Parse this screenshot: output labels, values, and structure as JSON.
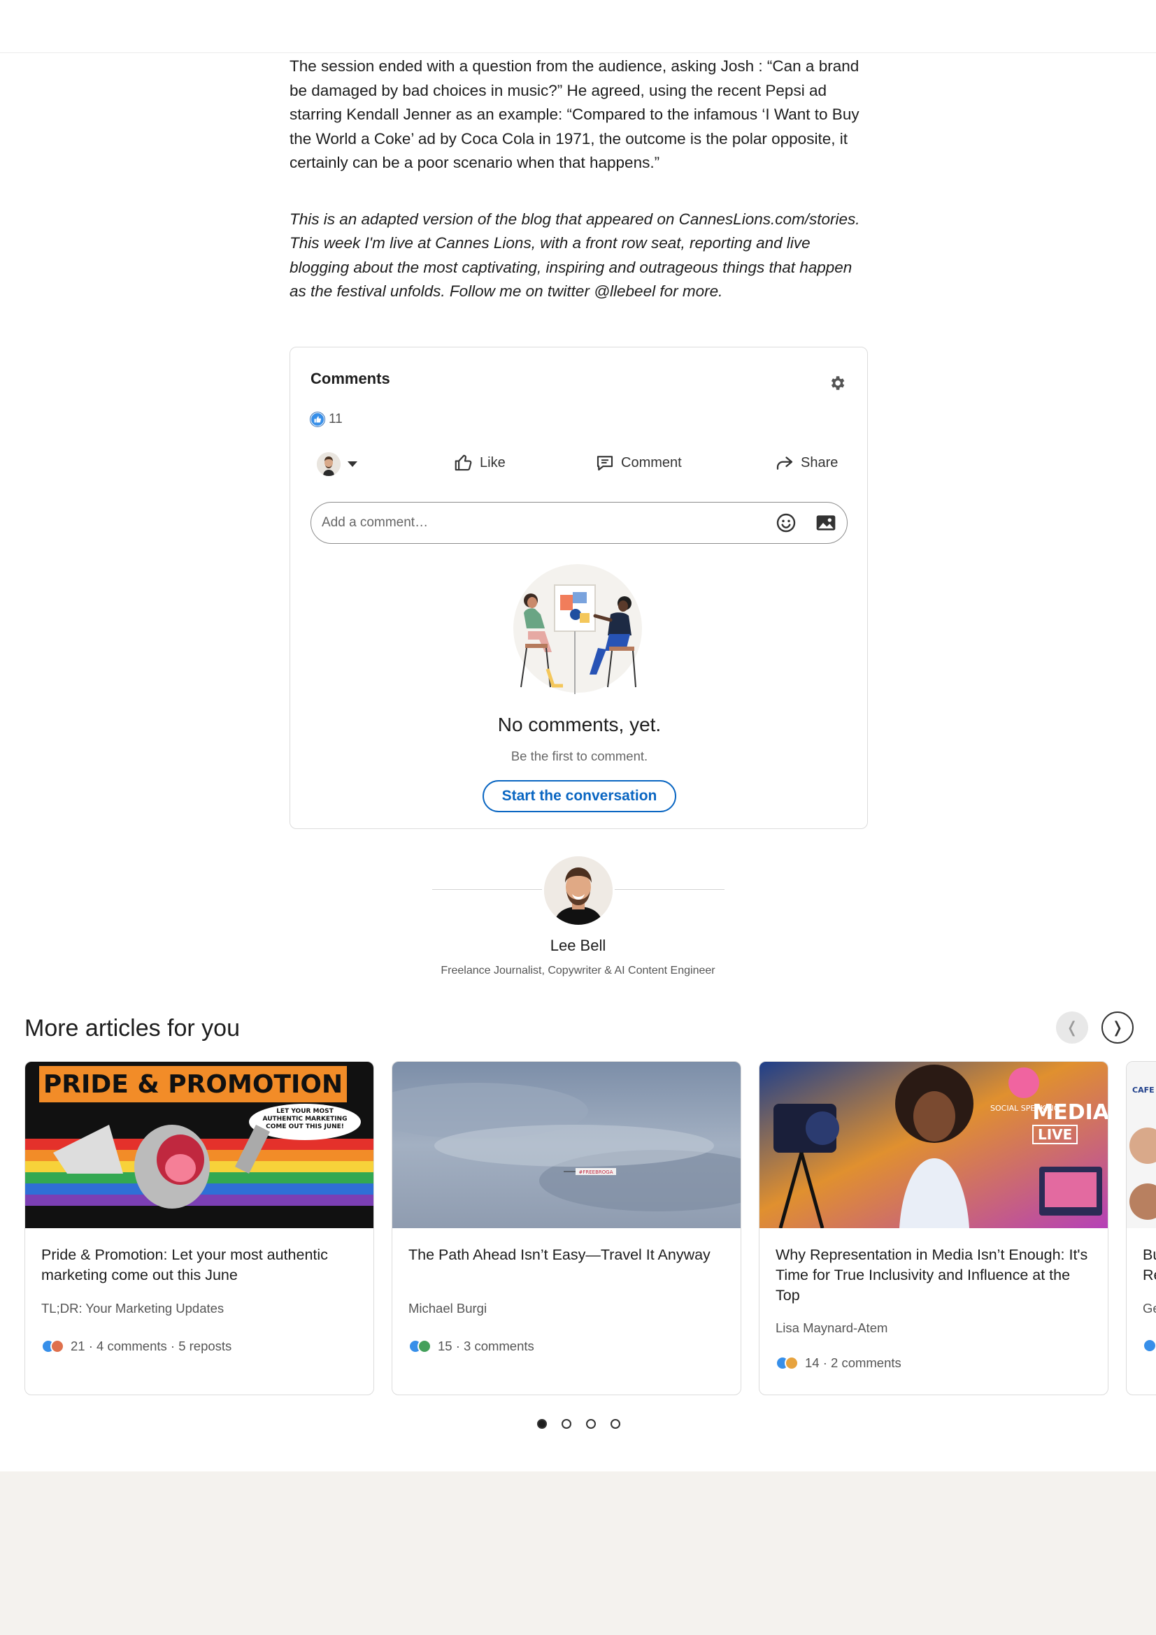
{
  "article": {
    "paragraph": "The session ended with a question from the audience, asking Josh : “Can a brand be damaged by bad choices in music?” He agreed, using the recent Pepsi ad starring Kendall Jenner as an example: “Compared to the infamous ‘I Want to Buy the World a Coke’ ad by Coca Cola in 1971, the outcome is the polar opposite, it certainly can be a poor scenario when that happens.”",
    "italic_note": "This is an adapted version of the blog that appeared on CannesLions.com/stories. This week I'm live at Cannes Lions, with a front row seat, reporting and live blogging about the most captivating, inspiring and outrageous things that happen as the festival unfolds. Follow me on twitter @llebeel for more."
  },
  "comments": {
    "title": "Comments",
    "settings_icon": "gear-icon",
    "reaction_count": "11",
    "actions": {
      "like": "Like",
      "comment": "Comment",
      "share": "Share"
    },
    "input_placeholder": "Add a comment…",
    "empty_title": "No comments, yet.",
    "empty_subtitle": "Be the first to comment.",
    "start_button": "Start the conversation"
  },
  "author": {
    "name": "Lee Bell",
    "headline": "Freelance Journalist, Copywriter & AI Content Engineer"
  },
  "more_articles": {
    "title": "More articles for you",
    "prev_glyph": "❬",
    "next_glyph": "❭",
    "cards": [
      {
        "title": "Pride & Promotion: Let your most authentic marketing come out this June",
        "author": "TL;DR: Your Marketing Updates",
        "stats": "21 · 4 comments · 5 reposts",
        "image_text": {
          "headline": "PRIDE & PROMOTION",
          "bubble": "LET YOUR MOST AUTHENTIC MARKETING COME OUT THIS JUNE!"
        }
      },
      {
        "title": "The Path Ahead Isn’t Easy—Travel It Anyway",
        "author": "Michael Burgi",
        "stats": "15 · 3 comments",
        "image_text": {
          "banner": "#FREEBROGA"
        }
      },
      {
        "title": "Why Representation in Media Isn’t Enough: It's Time for True Inclusivity and Influence at the Top",
        "author": "Lisa Maynard-Atem",
        "stats": "14 · 2 comments",
        "image_text": {
          "line1": "SOCIAL SPEAKING",
          "media": "MEDIA",
          "live": "LIVE"
        }
      },
      {
        "title_fragment": "Bu\nRe",
        "author_fragment": "Ge",
        "image_text": {
          "top": "CAFE BUSIE"
        }
      }
    ]
  },
  "pagination": {
    "count": 4,
    "active": 0
  },
  "colors": {
    "accent_blue": "#0a66c2",
    "like_blue": "#378fe9",
    "footer_bg": "#f4f2ee"
  }
}
